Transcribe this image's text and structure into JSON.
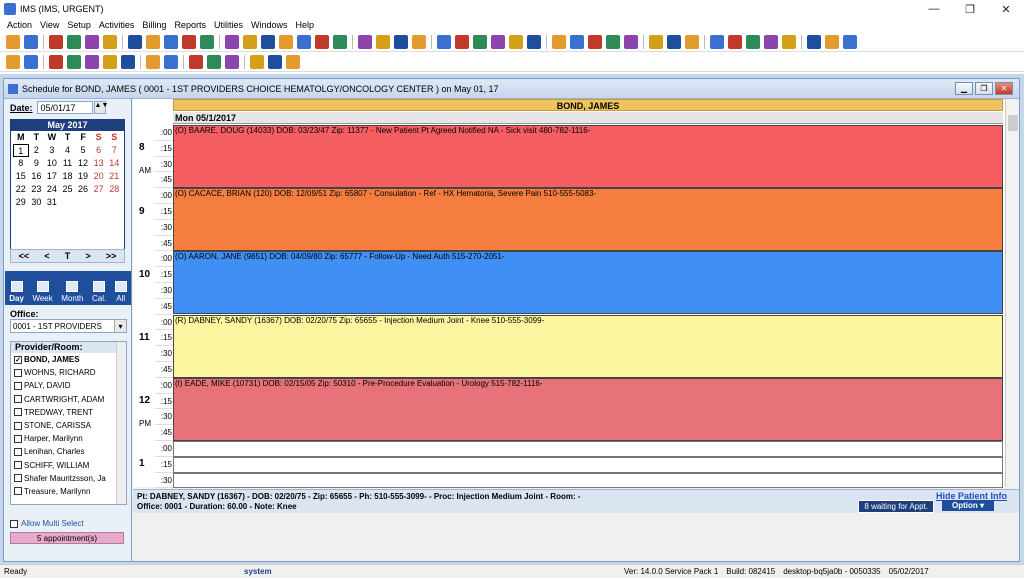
{
  "app": {
    "title": "IMS (IMS, URGENT)"
  },
  "menu": [
    "Action",
    "View",
    "Setup",
    "Activities",
    "Billing",
    "Reports",
    "Utilities",
    "Windows",
    "Help"
  ],
  "child": {
    "title": "Schedule for BOND, JAMES ( 0001 - 1ST PROVIDERS CHOICE HEMATOLGY/ONCOLOGY CENTER )  on  May 01, 17"
  },
  "left": {
    "date_label": "Date:",
    "date_value": "05/01/17",
    "calendar": {
      "month": "May 2017",
      "weekdays": [
        "M",
        "T",
        "W",
        "T",
        "F",
        "S",
        "S"
      ],
      "days": [
        "1",
        "2",
        "3",
        "4",
        "5",
        "6",
        "7",
        "8",
        "9",
        "10",
        "11",
        "12",
        "13",
        "14",
        "15",
        "16",
        "17",
        "18",
        "19",
        "20",
        "21",
        "22",
        "23",
        "24",
        "25",
        "26",
        "27",
        "28",
        "29",
        "30",
        "31"
      ]
    },
    "nav": [
      "<<",
      "<",
      "T",
      ">",
      ">>"
    ],
    "views": [
      "Day",
      "Week",
      "Month",
      "Cal.",
      "All"
    ],
    "office_label": "Office:",
    "office_value": "0001 - 1ST PROVIDERS",
    "provider_header": "Provider/Room:",
    "providers": [
      "BOND, JAMES",
      "WOHNS, RICHARD",
      "PALY, DAVID",
      "CARTWRIGHT, ADAM",
      "TREDWAY, TRENT",
      "STONE, CARISSA",
      "Harper, Marilynn",
      "Lenihan, Charles",
      "SCHIFF, WILLIAM",
      "Shafer Mauritzsson, Ja",
      "Treasure, Marilynn"
    ],
    "multi_label": "Allow Multi Select",
    "appt_count": "5 appointment(s)"
  },
  "schedule": {
    "provider": "BOND, JAMES",
    "day": "Mon 05/1/2017",
    "hours": [
      "8",
      "9",
      "10",
      "11",
      "12",
      "1"
    ],
    "ampm": {
      "am": "AM",
      "pm": "PM"
    },
    "slots": [
      ":00",
      ":15",
      ":30",
      ":45"
    ],
    "appointments": [
      {
        "text": "(O)  BAARE, DOUG  (14033)  DOB: 03/23/47  Zip: 11377 -  New Patient  Pt Agreed  Notified  NA - Sick visit    480-782-1116-",
        "color": "#f55f62"
      },
      {
        "text": "(O)  CACACE, BRIAN  (120)  DOB: 12/09/51  Zip: 65807 -  Consulation - Ref - HX Hematoria, Severe Pain    510-555-5083-",
        "color": "#f57d3f"
      },
      {
        "text": "(O)  AARON, JANE  (9851)  DOB: 04/09/80  Zip: 65777 -  Follow-Up - Need Auth    515-270-2051-",
        "color": "#3f8ff5"
      },
      {
        "text": "(R)  DABNEY, SANDY  (16367)  DOB: 02/20/75  Zip: 65655 -  Injection Medium Joint  - Knee    510-555-3099-",
        "color": "#fbf5a0"
      },
      {
        "text": "(I)  EADE, MIKE  (10731)  DOB: 02/15/05  Zip: 50310 -  Pre-Procedure Evaluation - Urology    515-782-1116-",
        "color": "#e8727a"
      }
    ]
  },
  "detail": {
    "line1": "Pt: DABNEY, SANDY  (16367) - DOB: 02/20/75 - Zip: 65655 - Ph: 510-555-3099-  - Proc: Injection Medium Joint  - Room:   -",
    "line2": "Office: 0001  - Duration: 60.00 - Note:  Knee",
    "hide": "Hide Patient Info",
    "waiting": "8 waiting for Appt.",
    "option": "Option"
  },
  "status": {
    "ready": "Ready",
    "user": "system",
    "version": "Ver: 14.0.0 Service Pack 1",
    "build": "Build: 082415",
    "machine": "desktop-bq5ja0b - 0050335",
    "date": "05/02/2017"
  }
}
